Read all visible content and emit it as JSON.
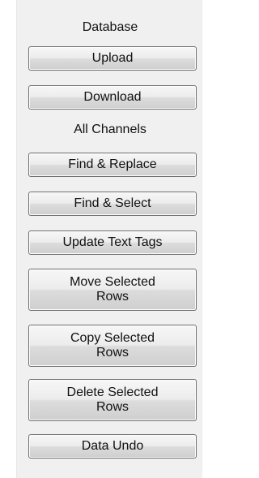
{
  "database": {
    "heading": "Database",
    "upload_label": "Upload",
    "download_label": "Download"
  },
  "channels": {
    "heading": "All Channels",
    "find_replace_label": "Find & Replace",
    "find_select_label": "Find & Select",
    "update_text_tags_label": "Update Text Tags",
    "move_selected_rows": {
      "line1": "Move Selected",
      "line2": "Rows"
    },
    "copy_selected_rows": {
      "line1": "Copy Selected",
      "line2": "Rows"
    },
    "delete_selected_rows": {
      "line1": "Delete Selected",
      "line2": "Rows"
    },
    "data_undo_label": "Data Undo"
  }
}
